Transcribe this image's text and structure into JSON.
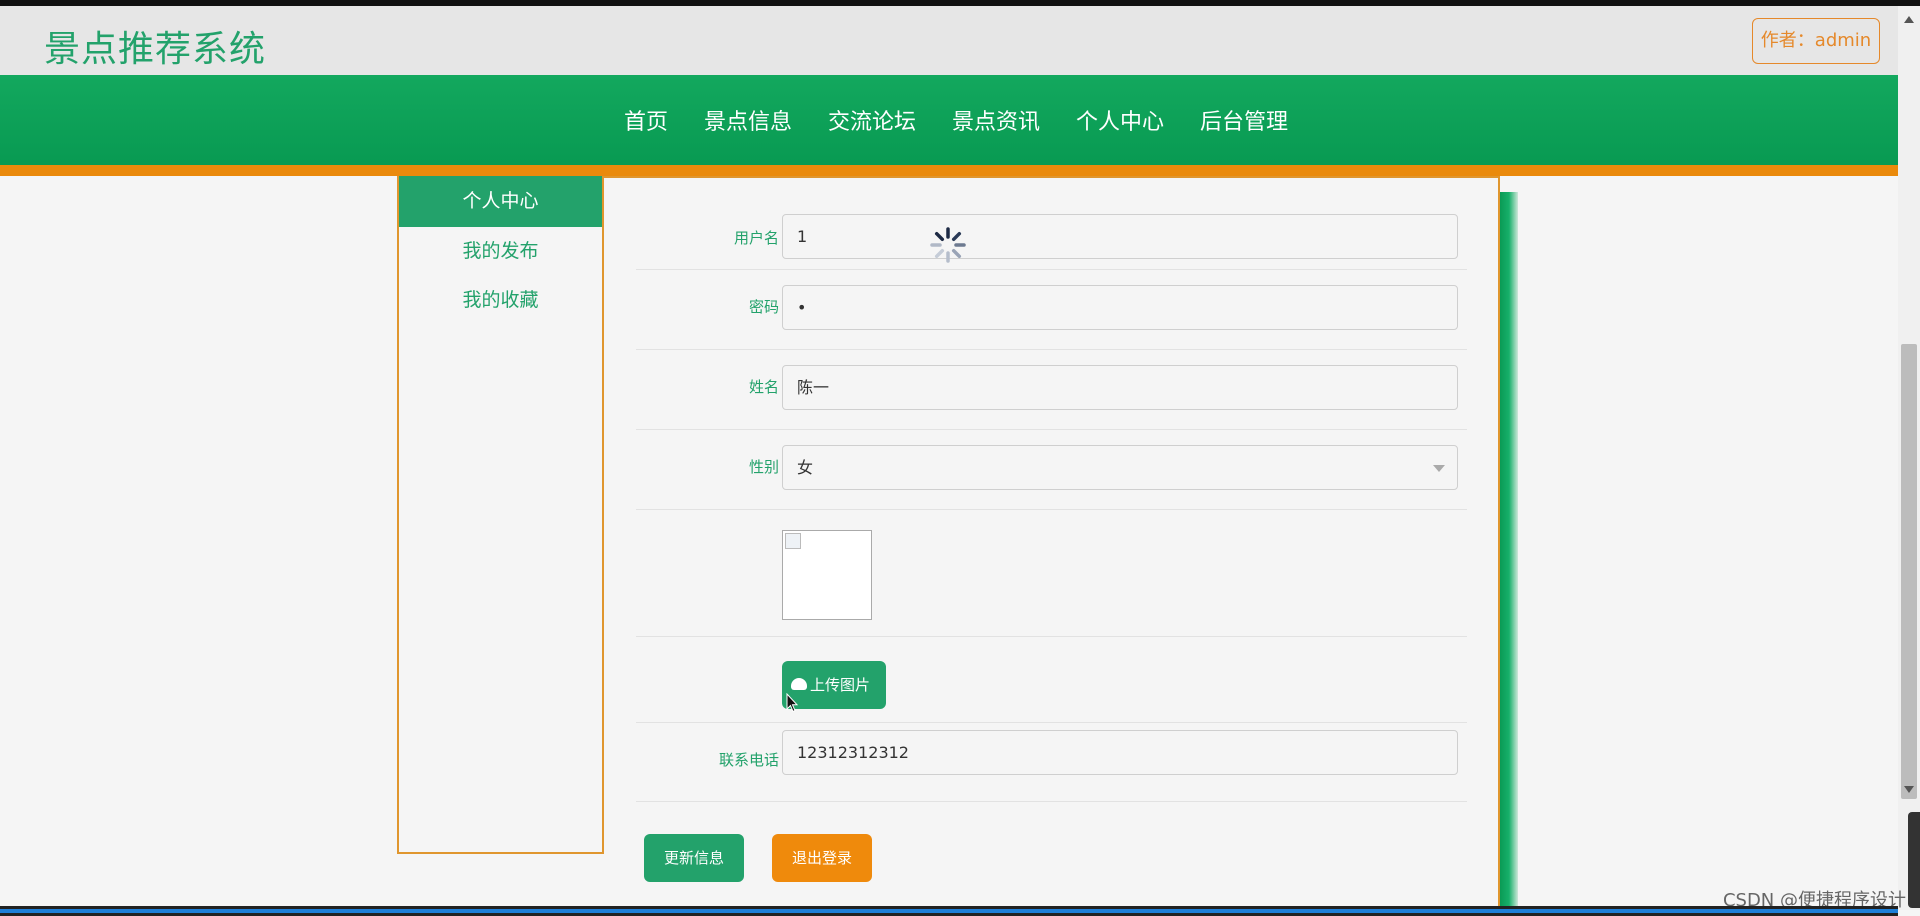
{
  "header": {
    "site_title": "景点推荐系统",
    "author_label": "作者：admin"
  },
  "nav": {
    "items": [
      "首页",
      "景点信息",
      "交流论坛",
      "景点资讯",
      "个人中心",
      "后台管理"
    ]
  },
  "sidebar": {
    "items": [
      {
        "label": "个人中心",
        "active": true
      },
      {
        "label": "我的发布",
        "active": false
      },
      {
        "label": "我的收藏",
        "active": false
      }
    ]
  },
  "form": {
    "username": {
      "label": "用户名",
      "value": "1"
    },
    "password": {
      "label": "密码",
      "value": "•"
    },
    "name": {
      "label": "姓名",
      "value": "陈一"
    },
    "gender": {
      "label": "性别",
      "value": "女"
    },
    "upload_label": "上传图片",
    "phone": {
      "label": "联系电话",
      "value": "12312312312"
    },
    "update_button": "更新信息",
    "logout_button": "退出登录"
  },
  "watermark": "CSDN @便捷程序设计",
  "colors": {
    "brand_green": "#23a26b",
    "accent_orange": "#ea8a0c"
  },
  "icons": [
    "loading-spinner-icon",
    "cloud-upload-icon",
    "broken-image-icon",
    "mouse-cursor-icon",
    "select-chevron-icon"
  ]
}
